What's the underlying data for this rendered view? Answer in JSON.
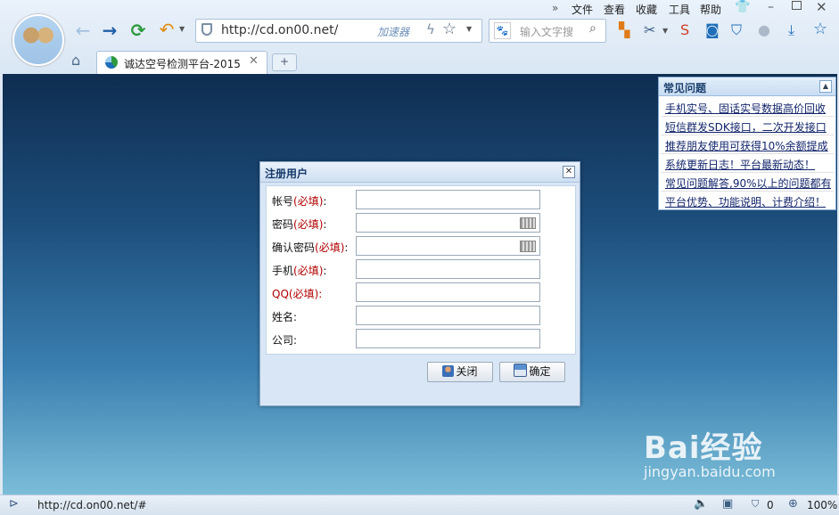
{
  "browser": {
    "menu": [
      "文件",
      "查看",
      "收藏",
      "工具",
      "帮助"
    ],
    "url": "http://cd.on00.net/",
    "accelerator_label": "加速器",
    "search_placeholder": "输入文字搜",
    "tab_title": "诚达空号检测平台-2015",
    "new_tab_label": "+"
  },
  "faq": {
    "title": "常见问题",
    "items": [
      "手机实号、固话实号数据高价回收",
      "短信群发SDK接口，二次开发接口",
      "推荐朋友使用可获得10%余额提成",
      "系统更新日志！平台最新动态！",
      "常见问题解答,90%以上的问题都有",
      "平台优势、功能说明、计费介绍！"
    ]
  },
  "dialog": {
    "title": "注册用户",
    "required_mark": "(必填)",
    "fields": [
      {
        "label": "帐号",
        "required": true
      },
      {
        "label": "密码",
        "required": true
      },
      {
        "label": "确认密码",
        "required": true
      },
      {
        "label": "手机",
        "required": true
      },
      {
        "label": "QQ",
        "required": true
      },
      {
        "label": "姓名",
        "required": false
      },
      {
        "label": "公司",
        "required": false
      }
    ],
    "close_button": "关闭",
    "ok_button": "确定"
  },
  "status": {
    "url": "http://cd.on00.net/#",
    "counter": "0",
    "zoom": "100%"
  },
  "watermark": {
    "brand": "Bai经验",
    "site": "jingyan.baidu.com"
  }
}
